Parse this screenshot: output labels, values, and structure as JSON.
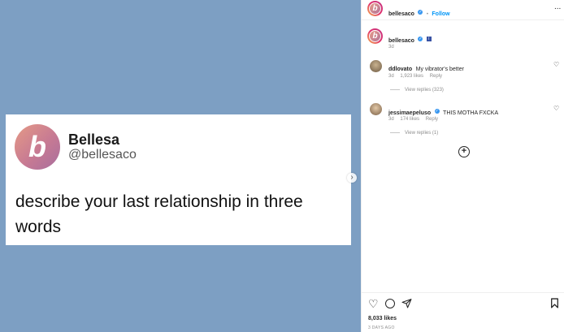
{
  "post": {
    "tweet": {
      "name": "Bellesa",
      "handle": "@bellesaco",
      "avatar_letter": "b",
      "text": "describe your last relationship in three words"
    }
  },
  "header": {
    "username": "bellesaco",
    "separator": "•",
    "follow_label": "Follow",
    "menu_label": "..."
  },
  "caption": {
    "username": "bellesaco",
    "time": "3d",
    "extra_badge": "i"
  },
  "comments": [
    {
      "username": "ddlovato",
      "text": "My vibrator's better",
      "time": "3d",
      "likes": "1,923 likes",
      "reply_label": "Reply",
      "view_replies": "View replies (323)"
    },
    {
      "username": "jessimaepeluso",
      "text": "THIS MOTHA FXCKA",
      "time": "3d",
      "likes": "174 likes",
      "reply_label": "Reply",
      "view_replies": "View replies (1)"
    }
  ],
  "actions": {
    "likes_count": "8,033 likes",
    "date": "3 DAYS AGO"
  },
  "colors": {
    "media_background": "#7d9fc3",
    "link_blue": "#0095f6",
    "verified_blue": "#3897f0"
  },
  "icons": {
    "load_more": "plus-circle-icon",
    "like": "heart-icon",
    "comment": "comment-icon",
    "share": "paper-plane-icon",
    "save": "bookmark-icon",
    "next": "chevron-right-icon"
  }
}
